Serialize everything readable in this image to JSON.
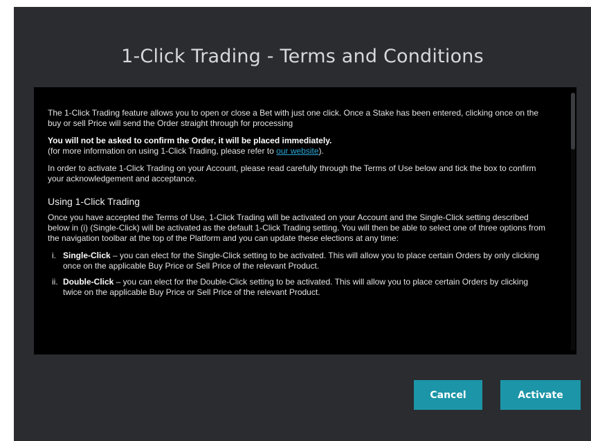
{
  "dialog": {
    "title": "1-Click Trading - Terms and Conditions"
  },
  "terms": {
    "intro": "The 1-Click Trading feature allows you to open or close a Bet with just one click. Once a Stake has been entered, clicking once on the buy or sell Price will send the Order straight through for processing",
    "warning": "You will not be asked to confirm the Order, it will be placed immediately.",
    "info_prefix": "(for more information on using 1-Click Trading, please refer to ",
    "info_link": "our website",
    "info_suffix": ").",
    "activate_instructions": "In order to activate 1-Click Trading on your Account, please read carefully through the Terms of Use below and tick the box to confirm your acknowledgement and acceptance.",
    "section_heading": "Using 1-Click Trading",
    "section_body": "Once you have accepted the Terms of Use, 1-Click Trading will be activated on your Account and the Single-Click setting described below in (i) (Single-Click) will be activated as the default 1-Click Trading setting. You will then be able to select one of three options from the navigation toolbar at the top of the Platform and you can update these elections at any time:",
    "options": [
      {
        "numeral": "i.",
        "name": "Single-Click",
        "text": " – you can elect for the Single-Click setting to be activated. This will allow you to place certain Orders by only clicking once on the applicable Buy Price or Sell Price of the relevant Product."
      },
      {
        "numeral": "ii.",
        "name": "Double-Click",
        "text": " – you can elect for the Double-Click setting to be activated. This will allow you to place certain Orders by clicking twice on the applicable Buy Price or Sell Price of the relevant Product."
      }
    ]
  },
  "buttons": {
    "cancel": "Cancel",
    "activate": "Activate"
  },
  "colors": {
    "dialog_background": "#2a2c30",
    "terms_background": "#000000",
    "button": "#1c95a8",
    "link": "#2aa8d8"
  }
}
